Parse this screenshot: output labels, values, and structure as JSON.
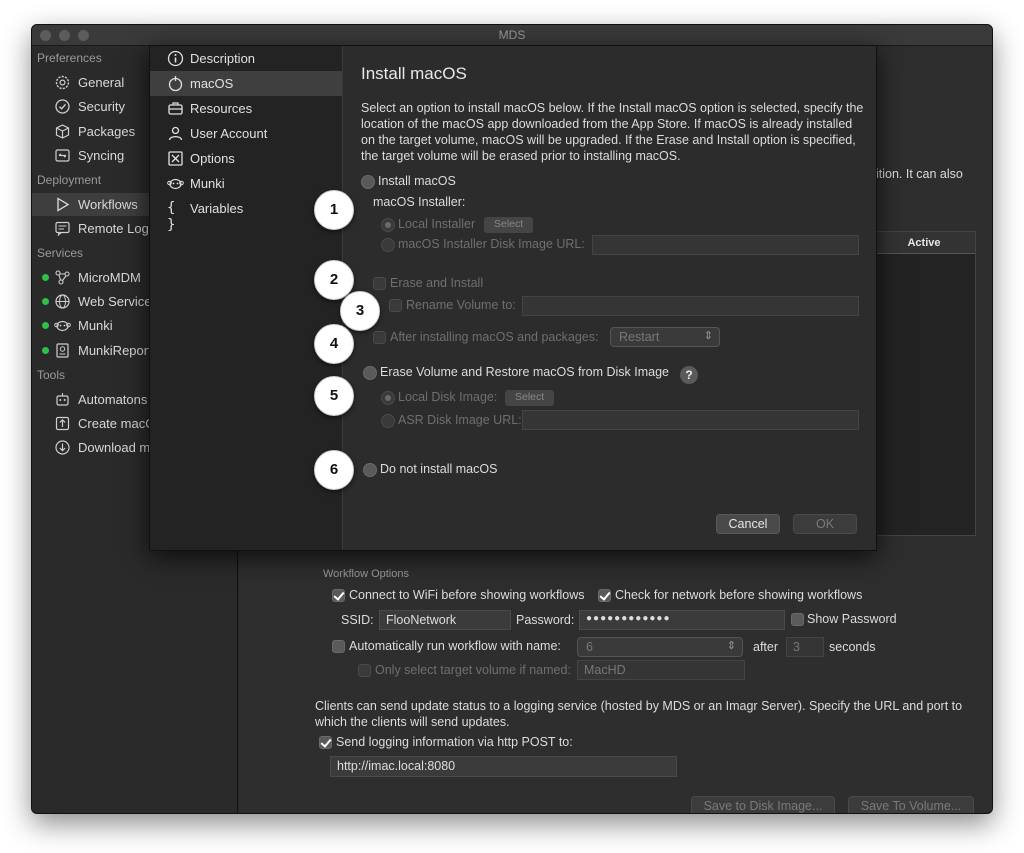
{
  "window": {
    "title": "MDS"
  },
  "sidebar": {
    "sections": [
      {
        "label": "Preferences",
        "items": [
          {
            "label": "General",
            "icon": "gear-icon"
          },
          {
            "label": "Security",
            "icon": "badge-check-icon"
          },
          {
            "label": "Packages",
            "icon": "package-icon"
          },
          {
            "label": "Syncing",
            "icon": "sync-icon"
          }
        ]
      },
      {
        "label": "Deployment",
        "items": [
          {
            "label": "Workflows",
            "icon": "play-icon"
          },
          {
            "label": "Remote Log",
            "icon": "message-icon"
          }
        ]
      },
      {
        "label": "Services",
        "items": [
          {
            "label": "MicroMDM",
            "icon": "network-icon"
          },
          {
            "label": "Web Service",
            "icon": "globe-icon"
          },
          {
            "label": "Munki",
            "icon": "munki-icon"
          },
          {
            "label": "MunkiReport",
            "icon": "report-icon"
          }
        ]
      },
      {
        "label": "Tools",
        "items": [
          {
            "label": "Automatons",
            "icon": "robot-icon"
          },
          {
            "label": "Create macO",
            "icon": "upload-icon"
          },
          {
            "label": "Download m",
            "icon": "download-icon"
          }
        ]
      }
    ],
    "status_color": "#30c048"
  },
  "main": {
    "partial_text": "ition. It can also",
    "table_header": "Active",
    "workflow_options_label": "Workflow Options",
    "connect_wifi": "Connect to WiFi before showing workflows",
    "check_network": "Check for network before showing workflows",
    "ssid_label": "SSID:",
    "ssid_value": "FlooNetwork",
    "password_label": "Password:",
    "password_value": "●●●●●●●●●●●●",
    "show_password": "Show Password",
    "auto_run": "Automatically run workflow with name:",
    "auto_run_value": "6",
    "after_label": "after",
    "after_value": "3",
    "seconds_label": "seconds",
    "only_select": "Only select target volume if named:",
    "only_select_value": "MacHD",
    "logging_desc": "Clients can send update status to a logging service (hosted by MDS or an Imagr Server). Specify the URL and port to which the clients will send updates.",
    "send_logging": "Send logging information via http POST to:",
    "logging_url": "http://imac.local:8080",
    "save_disk_image": "Save to Disk Image...",
    "save_volume": "Save To Volume..."
  },
  "sheet": {
    "nav": [
      {
        "label": "Description",
        "icon": "info-icon"
      },
      {
        "label": "macOS",
        "icon": "macos-icon"
      },
      {
        "label": "Resources",
        "icon": "briefcase-icon"
      },
      {
        "label": "User Account",
        "icon": "user-icon"
      },
      {
        "label": "Options",
        "icon": "options-icon"
      },
      {
        "label": "Munki",
        "icon": "munki-icon"
      },
      {
        "label": "Variables",
        "icon": "braces-icon"
      }
    ],
    "title": "Install macOS",
    "description": "Select an option to install macOS below. If the Install macOS option is selected, specify the location of the macOS app downloaded from the App Store. If macOS is already installed on the target volume, macOS will be upgraded. If the Erase and Install option is specified, the target volume will be erased prior to installing macOS.",
    "install_macos": "Install macOS",
    "macos_installer": "macOS Installer:",
    "local_installer": "Local Installer",
    "select": "Select",
    "disk_image_url": "macOS Installer Disk Image URL:",
    "erase_install": "Erase and Install",
    "rename_volume": "Rename Volume to:",
    "after_installing": "After installing macOS and packages:",
    "after_installing_value": "Restart",
    "erase_restore": "Erase Volume and Restore macOS from Disk Image",
    "help": "?",
    "local_disk_image": "Local Disk Image:",
    "asr_url": "ASR Disk Image URL:",
    "do_not_install": "Do not install macOS",
    "cancel": "Cancel",
    "ok": "OK"
  },
  "callouts": [
    "1",
    "2",
    "3",
    "4",
    "5",
    "6"
  ]
}
